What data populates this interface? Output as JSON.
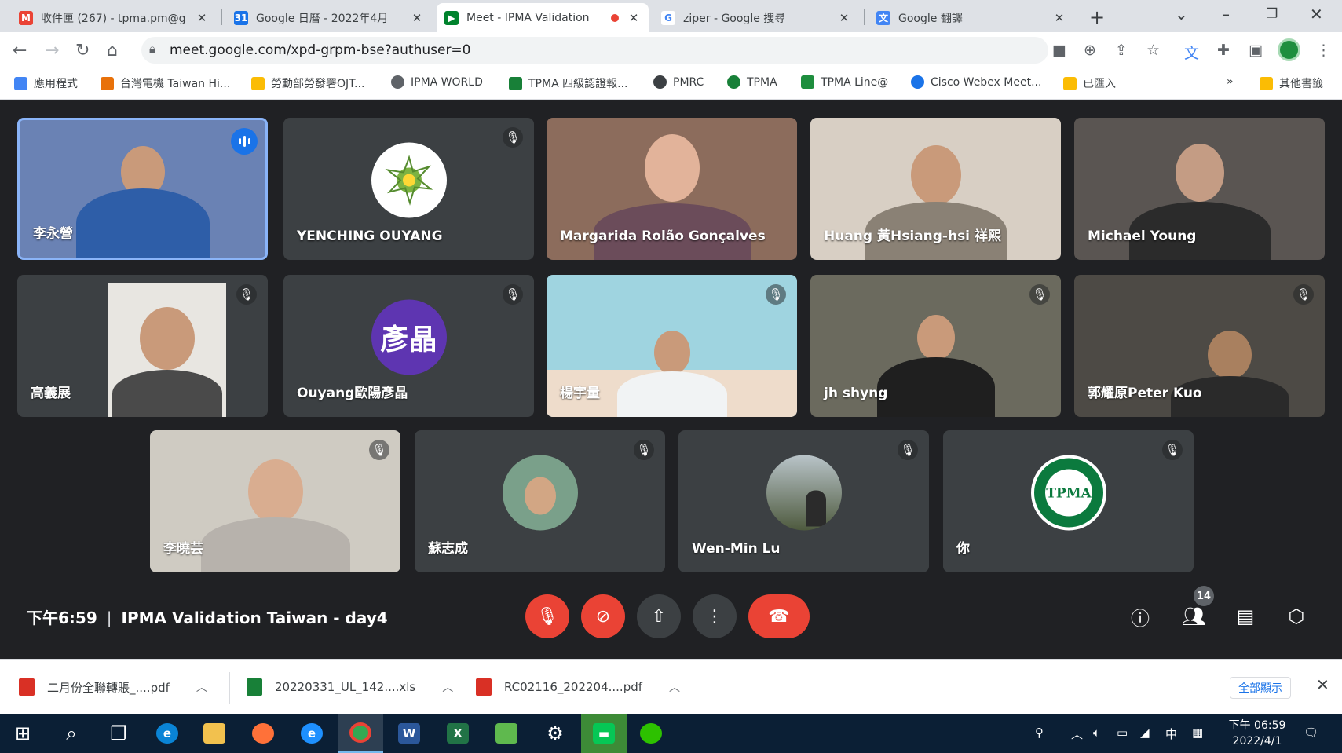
{
  "browser": {
    "tabs": [
      {
        "title": "收件匣 (267) - tpma.pm@g",
        "icon": "gmail-icon",
        "color": "#ea4335"
      },
      {
        "title": "Google 日曆 - 2022年4月",
        "icon": "calendar-icon",
        "color": "#1a73e8"
      },
      {
        "title": "Meet - IPMA Validation",
        "icon": "meet-icon",
        "color": "#00832d"
      },
      {
        "title": "ziper - Google 搜尋",
        "icon": "google-icon",
        "color": "#4285f4"
      },
      {
        "title": "Google 翻譯",
        "icon": "translate-icon",
        "color": "#4285f4"
      }
    ],
    "new_tab": "+",
    "url": "meet.google.com/xpd-grpm-bse?authuser=0",
    "bookmarks": [
      {
        "label": "應用程式",
        "color": "#4285f4"
      },
      {
        "label": "台灣電機 Taiwan Hi...",
        "color": "#e8710a"
      },
      {
        "label": "勞動部勞發署OJT...",
        "color": "#fbbc04"
      },
      {
        "label": "IPMA WORLD",
        "color": "#5f6368"
      },
      {
        "label": "TPMA 四級認證報...",
        "color": "#188038"
      },
      {
        "label": "PMRC",
        "color": "#3c4043"
      },
      {
        "label": "TPMA",
        "color": "#188038"
      },
      {
        "label": "TPMA Line@",
        "color": "#1e8e3e"
      },
      {
        "label": "Cisco Webex Meet...",
        "color": "#1a73e8"
      },
      {
        "label": "已匯入",
        "color": "#fbbc04"
      }
    ],
    "more_bookmarks": "»",
    "other_bookmarks": "其他書籤"
  },
  "meet": {
    "tiles": [
      {
        "name": "李永營",
        "muted": false,
        "speaking": true,
        "bg": "#6a82b4",
        "type": "video"
      },
      {
        "name": "YENCHING OUYANG",
        "muted": true,
        "speaking": false,
        "bg": "#3c4043",
        "type": "avatar-image"
      },
      {
        "name": "Margarida Rolão Gonçalves",
        "muted": false,
        "speaking": false,
        "bg": "#8c6c5c",
        "type": "video"
      },
      {
        "name": "Huang 黃Hsiang-hsi 祥熙",
        "muted": false,
        "speaking": false,
        "bg": "#d8cfc4",
        "type": "video"
      },
      {
        "name": "Michael Young",
        "muted": false,
        "speaking": false,
        "bg": "#5a5552",
        "type": "video"
      },
      {
        "name": "高義展",
        "muted": true,
        "speaking": false,
        "bg": "#3c4043",
        "type": "video"
      },
      {
        "name": "Ouyang歐陽彥晶",
        "muted": true,
        "speaking": false,
        "bg": "#3c4043",
        "type": "avatar-letter",
        "avatar_text": "彥晶"
      },
      {
        "name": "楊宇量",
        "muted": true,
        "speaking": false,
        "bg": "#9fd4e0",
        "type": "video"
      },
      {
        "name": "jh shyng",
        "muted": true,
        "speaking": false,
        "bg": "#6b6a5e",
        "type": "video"
      },
      {
        "name": "郭耀原Peter Kuo",
        "muted": true,
        "speaking": false,
        "bg": "#4d4a45",
        "type": "video"
      },
      {
        "name": "李曉芸",
        "muted": true,
        "speaking": false,
        "bg": "#cfcbc2",
        "type": "video"
      },
      {
        "name": "蘇志成",
        "muted": true,
        "speaking": false,
        "bg": "#3c4043",
        "type": "avatar-image"
      },
      {
        "name": "Wen-Min Lu",
        "muted": true,
        "speaking": false,
        "bg": "#3c4043",
        "type": "avatar-image"
      },
      {
        "name": "你",
        "muted": true,
        "speaking": false,
        "bg": "#3c4043",
        "type": "avatar-image",
        "logo_text": "TPMA"
      }
    ],
    "time": "下午6:59",
    "meeting_title": "IPMA Validation Taiwan - day4",
    "participant_count": "14"
  },
  "downloads": [
    {
      "name": "二月份全聯轉賬_....pdf",
      "icon": "pdf-icon",
      "color": "#d93025"
    },
    {
      "name": "20220331_UL_142....xls",
      "icon": "excel-icon",
      "color": "#188038"
    },
    {
      "name": "RC02116_202204....pdf",
      "icon": "pdf-icon",
      "color": "#d93025"
    }
  ],
  "downloads_show_all": "全部顯示",
  "taskbar": {
    "clock_time": "下午 06:59",
    "clock_date": "2022/4/1",
    "ime": "中"
  }
}
